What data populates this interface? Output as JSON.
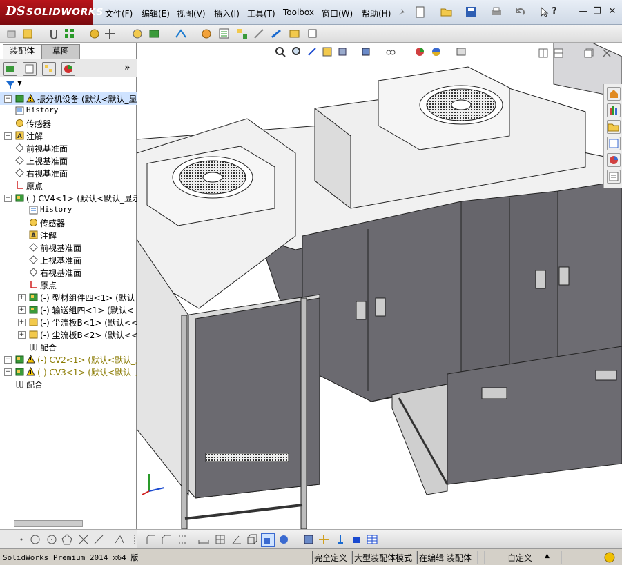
{
  "app": {
    "logo_ds": "DS",
    "logo_name": "SOLIDWORKS"
  },
  "menu": [
    {
      "label": "文件(F)"
    },
    {
      "label": "编辑(E)"
    },
    {
      "label": "视图(V)"
    },
    {
      "label": "插入(I)"
    },
    {
      "label": "工具(T)"
    },
    {
      "label": "Toolbox"
    },
    {
      "label": "窗口(W)"
    },
    {
      "label": "帮助(H)"
    }
  ],
  "window_controls": {
    "help": "?",
    "minimize": "—",
    "restore": "❐",
    "close": "✕"
  },
  "tabs": [
    {
      "label": "装配体"
    },
    {
      "label": "草图"
    }
  ],
  "tree": [
    {
      "label": "振分机设备  (默认<默认_显",
      "icon": "assembly-warning-icon",
      "level": 0,
      "expander": "−",
      "warn": true,
      "selected": true
    },
    {
      "label": "History",
      "icon": "history-icon",
      "level": 1,
      "mono": true
    },
    {
      "label": "传感器",
      "icon": "sensor-icon",
      "level": 1
    },
    {
      "label": "注解",
      "icon": "annotation-icon",
      "level": 1,
      "expander": "+"
    },
    {
      "label": "前视基准面",
      "icon": "plane-icon",
      "level": 1
    },
    {
      "label": "上视基准面",
      "icon": "plane-icon",
      "level": 1
    },
    {
      "label": "右视基准面",
      "icon": "plane-icon",
      "level": 1
    },
    {
      "label": "原点",
      "icon": "origin-icon",
      "level": 1
    },
    {
      "label": "(-) CV4<1> (默认<默认_显示",
      "icon": "subassembly-icon",
      "level": 1,
      "expander": "−"
    },
    {
      "label": "History",
      "icon": "history-icon",
      "level": 2,
      "mono": true
    },
    {
      "label": "传感器",
      "icon": "sensor-icon",
      "level": 2
    },
    {
      "label": "注解",
      "icon": "annotation-icon",
      "level": 2
    },
    {
      "label": "前视基准面",
      "icon": "plane-icon",
      "level": 2
    },
    {
      "label": "上视基准面",
      "icon": "plane-icon",
      "level": 2
    },
    {
      "label": "右视基准面",
      "icon": "plane-icon",
      "level": 2
    },
    {
      "label": "原点",
      "icon": "origin-icon",
      "level": 2
    },
    {
      "label": "(-) 型材组件四<1> (默认",
      "icon": "subassembly-icon",
      "level": 2,
      "expander": "+"
    },
    {
      "label": "(-) 输送组四<1> (默认<",
      "icon": "subassembly-icon",
      "level": 2,
      "expander": "+"
    },
    {
      "label": "(-) 尘流板B<1> (默认<<",
      "icon": "part-icon",
      "level": 2,
      "expander": "+"
    },
    {
      "label": "(-) 尘流板B<2> (默认<<",
      "icon": "part-icon",
      "level": 2,
      "expander": "+"
    },
    {
      "label": "配合",
      "icon": "mates-icon",
      "level": 2
    },
    {
      "label": "(-) CV2<1> (默认<默认_显",
      "icon": "subassembly-warning-icon",
      "level": 1,
      "expander": "+",
      "warn": true,
      "olive": true
    },
    {
      "label": "(-) CV3<1> (默认<默认_显",
      "icon": "subassembly-warning-icon",
      "level": 1,
      "expander": "+",
      "warn": true,
      "olive": true
    },
    {
      "label": "配合",
      "icon": "mates-icon",
      "level": 1
    }
  ],
  "status": {
    "product": "SolidWorks Premium 2014 x64 版",
    "defined": "完全定义",
    "mode": "大型装配体模式",
    "editing": "在编辑 装配体",
    "units": "自定义",
    "units_arrow": "▲"
  },
  "colors": {
    "accent_red": "#b8141a",
    "selection": "#cfe3ff",
    "machine_gray": "#6b6a70",
    "warning": "#f0c000"
  }
}
